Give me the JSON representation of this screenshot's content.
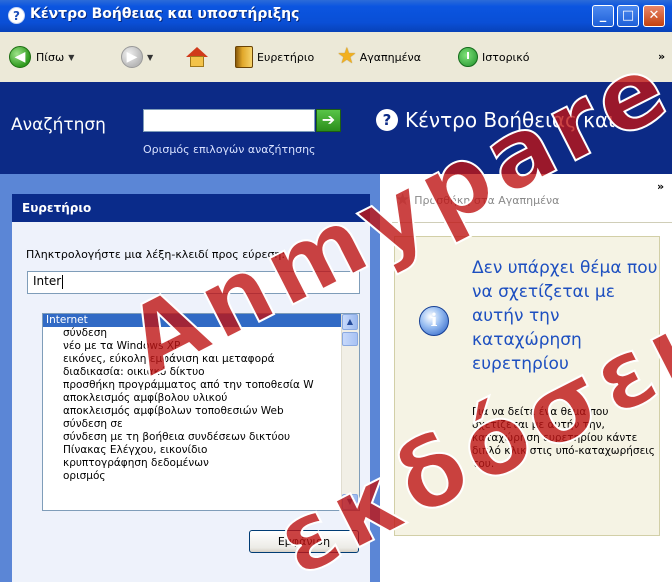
{
  "window": {
    "title": "Κέντρο Βοήθειας και υποστήριξης"
  },
  "toolbar": {
    "back_label": "Πίσω",
    "index_label": "Ευρετήριο",
    "favorites_label": "Αγαπημένα",
    "history_label": "Ιστορικό",
    "more_chevron": "»"
  },
  "search": {
    "label": "Αναζήτηση",
    "value": "",
    "options_link": "Ορισμός επιλογών αναζήτησης",
    "go_icon": "arrow-right"
  },
  "header": {
    "title": "Κέντρο Βοήθειας και"
  },
  "index_pane": {
    "heading": "Ευρετήριο",
    "prompt": "Πληκτρολογήστε μια λέξη-κλειδί προς εύρεση:",
    "input_value": "Inter",
    "items": [
      {
        "text": "Internet",
        "selected": true,
        "indent": false
      },
      {
        "text": "σύνδεση",
        "selected": false,
        "indent": true
      },
      {
        "text": "νέο με τα Windows XP",
        "selected": false,
        "indent": true
      },
      {
        "text": "εικόνες, εύκολη εμφάνιση και μεταφορά",
        "selected": false,
        "indent": true
      },
      {
        "text": "διαδικασία: οικιακό δίκτυο",
        "selected": false,
        "indent": true
      },
      {
        "text": "προσθήκη προγράμματος από την τοποθεσία W",
        "selected": false,
        "indent": true
      },
      {
        "text": "αποκλεισμός αμφίβολου υλικού",
        "selected": false,
        "indent": true
      },
      {
        "text": "αποκλεισμός αμφίβολων τοποθεσιών Web",
        "selected": false,
        "indent": true
      },
      {
        "text": "σύνδεση σε",
        "selected": false,
        "indent": true
      },
      {
        "text": "σύνδεση με τη βοήθεια συνδέσεων δικτύου",
        "selected": false,
        "indent": true
      },
      {
        "text": "Πίνακας Ελέγχου, εικονίδιο",
        "selected": false,
        "indent": true
      },
      {
        "text": "κρυπτογράφηση δεδομένων",
        "selected": false,
        "indent": true
      },
      {
        "text": "ορισμός",
        "selected": false,
        "indent": true
      }
    ],
    "show_button": "Εμφάνιση"
  },
  "right_pane": {
    "add_favorites": "Προσθήκη στα Αγαπημένα",
    "more_chevron": "»",
    "info_title": "Δεν υπάρχει θέμα που να σχετίζεται με αυτήν την καταχώρηση ευρετηρίου",
    "info_text": "Για να δείτε ένα θέμα που σχετίζεται με αυτήν την, καταχώρηση ευρετηρίου κάντε διπλό κλικ στις υπό-καταχωρήσεις του."
  },
  "watermark": {
    "line1": "Anmypare",
    "line2": "εκδόσεις"
  },
  "colors": {
    "title_bar": "#0b55e0",
    "search_band": "#0c2a86",
    "left_pane": "#5b86d6",
    "index_heading": "#0a2b8a",
    "selection": "#316ac5",
    "info_title": "#1d4fc0",
    "watermark": "#be1414"
  }
}
